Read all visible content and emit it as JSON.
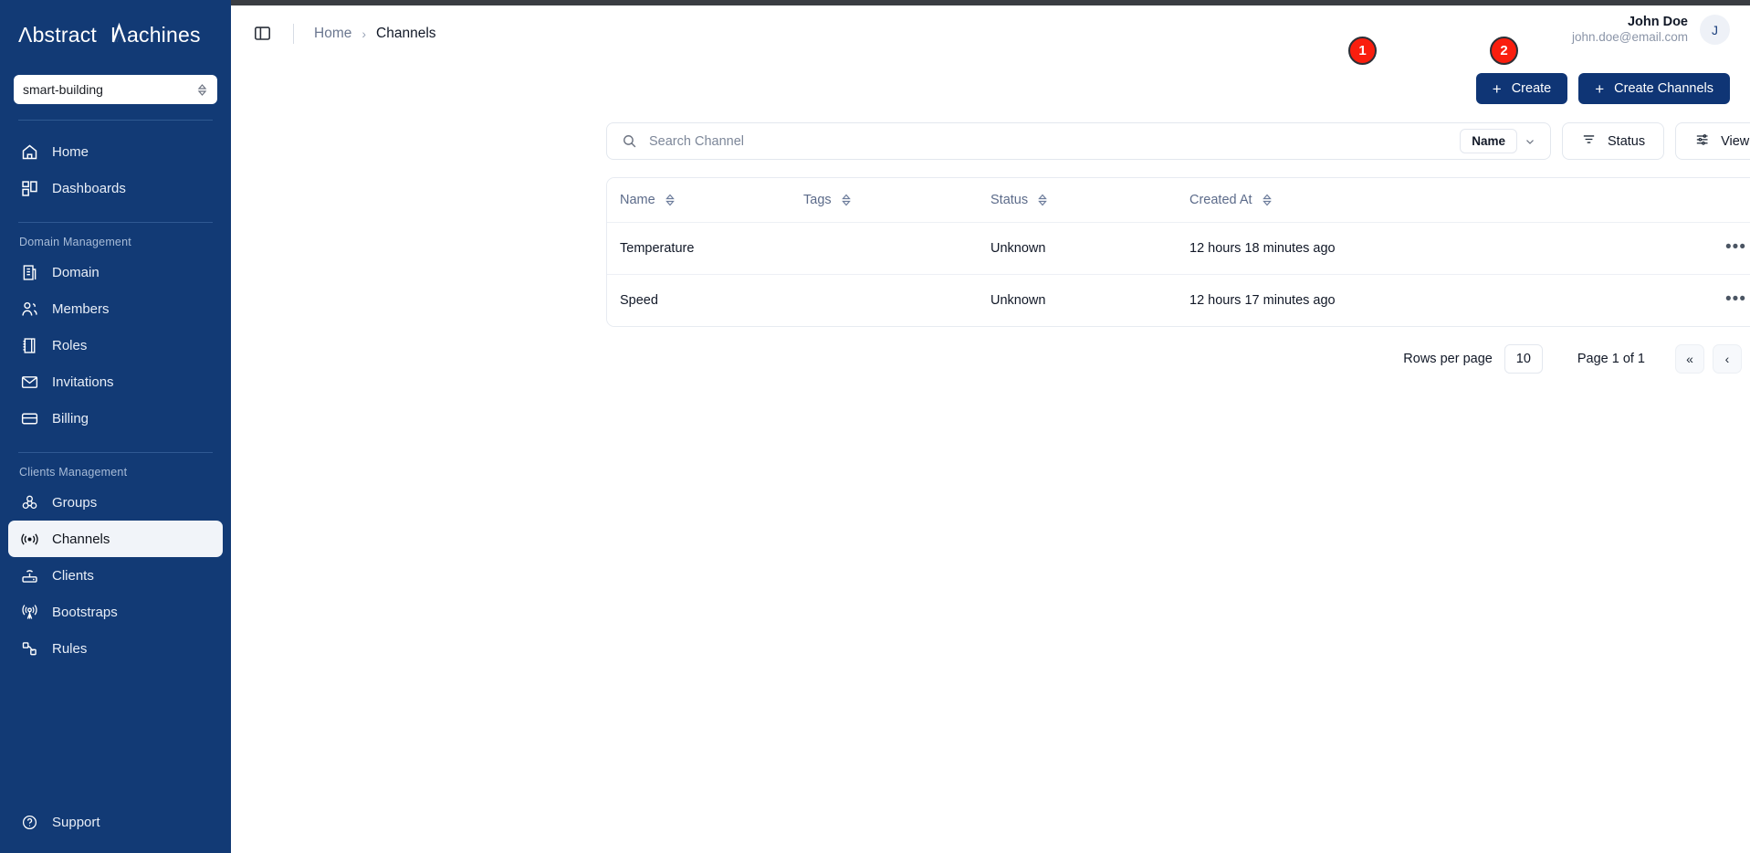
{
  "brand": {
    "logo_text": "Abstract Machines",
    "sidebar_bg": "#123a75"
  },
  "sidebar": {
    "domain_selector": {
      "value": "smart-building",
      "icon": "chevron-updown-icon"
    },
    "top_items": [
      {
        "label": "Home",
        "icon": "home-icon",
        "active": false
      },
      {
        "label": "Dashboards",
        "icon": "dashboards-grid-icon",
        "active": false
      }
    ],
    "sections": [
      {
        "label": "Domain Management",
        "items": [
          {
            "label": "Domain",
            "icon": "building-icon",
            "active": false
          },
          {
            "label": "Members",
            "icon": "users-icon",
            "active": false
          },
          {
            "label": "Roles",
            "icon": "book-icon",
            "active": false
          },
          {
            "label": "Invitations",
            "icon": "envelope-icon",
            "active": false
          },
          {
            "label": "Billing",
            "icon": "credit-card-icon",
            "active": false
          }
        ]
      },
      {
        "label": "Clients Management",
        "items": [
          {
            "label": "Groups",
            "icon": "groups-cubes-icon",
            "active": false
          },
          {
            "label": "Channels",
            "icon": "broadcast-icon",
            "active": true
          },
          {
            "label": "Clients",
            "icon": "router-icon",
            "active": false
          },
          {
            "label": "Bootstraps",
            "icon": "antenna-icon",
            "active": false
          },
          {
            "label": "Rules",
            "icon": "nodes-icon",
            "active": false
          }
        ]
      }
    ],
    "support": {
      "label": "Support",
      "icon": "question-circle-icon"
    }
  },
  "topbar": {
    "sidebar_toggle_icon": "panel-toggle-icon",
    "breadcrumb": {
      "home": "Home",
      "separator": "›",
      "current": "Channels"
    },
    "user": {
      "name": "John Doe",
      "email": "john.doe@email.com",
      "avatar_initial": "J"
    }
  },
  "actions": {
    "create": {
      "label": "Create",
      "icon": "plus-icon",
      "badge": "1"
    },
    "create_channels": {
      "label": "Create Channels",
      "icon": "plus-icon",
      "badge": "2"
    },
    "badge_color": "#fa1e0e",
    "button_color": "#0f3575"
  },
  "toolbar": {
    "search": {
      "placeholder": "Search Channel",
      "value": "",
      "icon": "search-icon"
    },
    "search_field_pill": {
      "label": "Name",
      "icon": "chevron-down-icon"
    },
    "status_button": {
      "label": "Status",
      "icon": "filter-icon"
    },
    "view_button": {
      "label": "View",
      "icon": "sliders-icon"
    }
  },
  "table": {
    "columns": [
      {
        "label": "Name",
        "sortable": true
      },
      {
        "label": "Tags",
        "sortable": true
      },
      {
        "label": "Status",
        "sortable": true
      },
      {
        "label": "Created At",
        "sortable": true
      },
      {
        "label": "",
        "sortable": false
      }
    ],
    "rows": [
      {
        "name": "Temperature",
        "tags": "",
        "status": "Unknown",
        "created_at": "12 hours 18 minutes ago",
        "menu": "•••"
      },
      {
        "name": "Speed",
        "tags": "",
        "status": "Unknown",
        "created_at": "12 hours 17 minutes ago",
        "menu": "•••"
      }
    ]
  },
  "pagination": {
    "rows_per_page_label": "Rows per page",
    "rows_per_page_value": "10",
    "page_info": "Page 1 of 1",
    "first_label": "«",
    "prev_label": "‹",
    "next_label": "›",
    "last_label": "»"
  }
}
